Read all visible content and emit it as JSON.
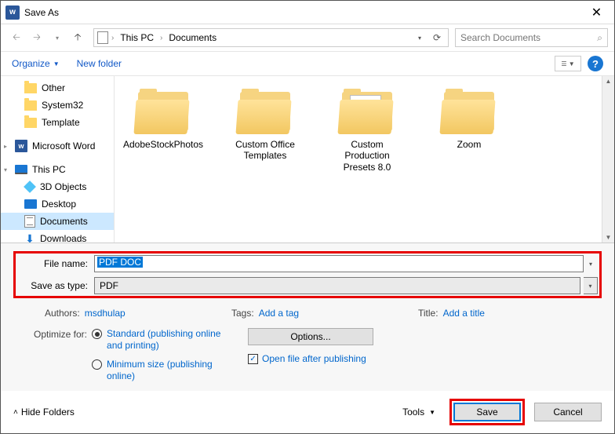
{
  "title": "Save As",
  "nav": {
    "location_parts": [
      "This PC",
      "Documents"
    ],
    "search_placeholder": "Search Documents"
  },
  "toolbar": {
    "organize": "Organize",
    "newfolder": "New folder"
  },
  "tree": {
    "items": [
      {
        "label": "Other",
        "icon": "folder",
        "level": 1
      },
      {
        "label": "System32",
        "icon": "folder",
        "level": 1
      },
      {
        "label": "Template",
        "icon": "folder",
        "level": 1
      },
      {
        "label": "Microsoft Word",
        "icon": "word",
        "level": 0
      },
      {
        "label": "This PC",
        "icon": "thispc",
        "level": 0,
        "expanded": true
      },
      {
        "label": "3D Objects",
        "icon": "3d",
        "level": 1
      },
      {
        "label": "Desktop",
        "icon": "desktop",
        "level": 1
      },
      {
        "label": "Documents",
        "icon": "docs",
        "level": 1,
        "selected": true
      },
      {
        "label": "Downloads",
        "icon": "dl",
        "level": 1
      }
    ]
  },
  "folders": [
    {
      "label": "AdobeStockPhotos",
      "variant": "plain"
    },
    {
      "label": "Custom Office Templates",
      "variant": "plain"
    },
    {
      "label": "Custom Production Presets 8.0",
      "variant": "custom1"
    },
    {
      "label": "Zoom",
      "variant": "plain"
    }
  ],
  "form": {
    "filename_label": "File name:",
    "filename_value": "PDF DOC",
    "type_label": "Save as type:",
    "type_value": "PDF"
  },
  "meta": {
    "authors_label": "Authors:",
    "authors_value": "msdhulap",
    "tags_label": "Tags:",
    "tags_value": "Add a tag",
    "title_label": "Title:",
    "title_value": "Add a title"
  },
  "optimize": {
    "label": "Optimize for:",
    "standard": "Standard (publishing online and printing)",
    "minimum": "Minimum size (publishing online)"
  },
  "options_btn": "Options...",
  "open_after": "Open file after publishing",
  "footer": {
    "hide": "Hide Folders",
    "tools": "Tools",
    "save": "Save",
    "cancel": "Cancel"
  }
}
